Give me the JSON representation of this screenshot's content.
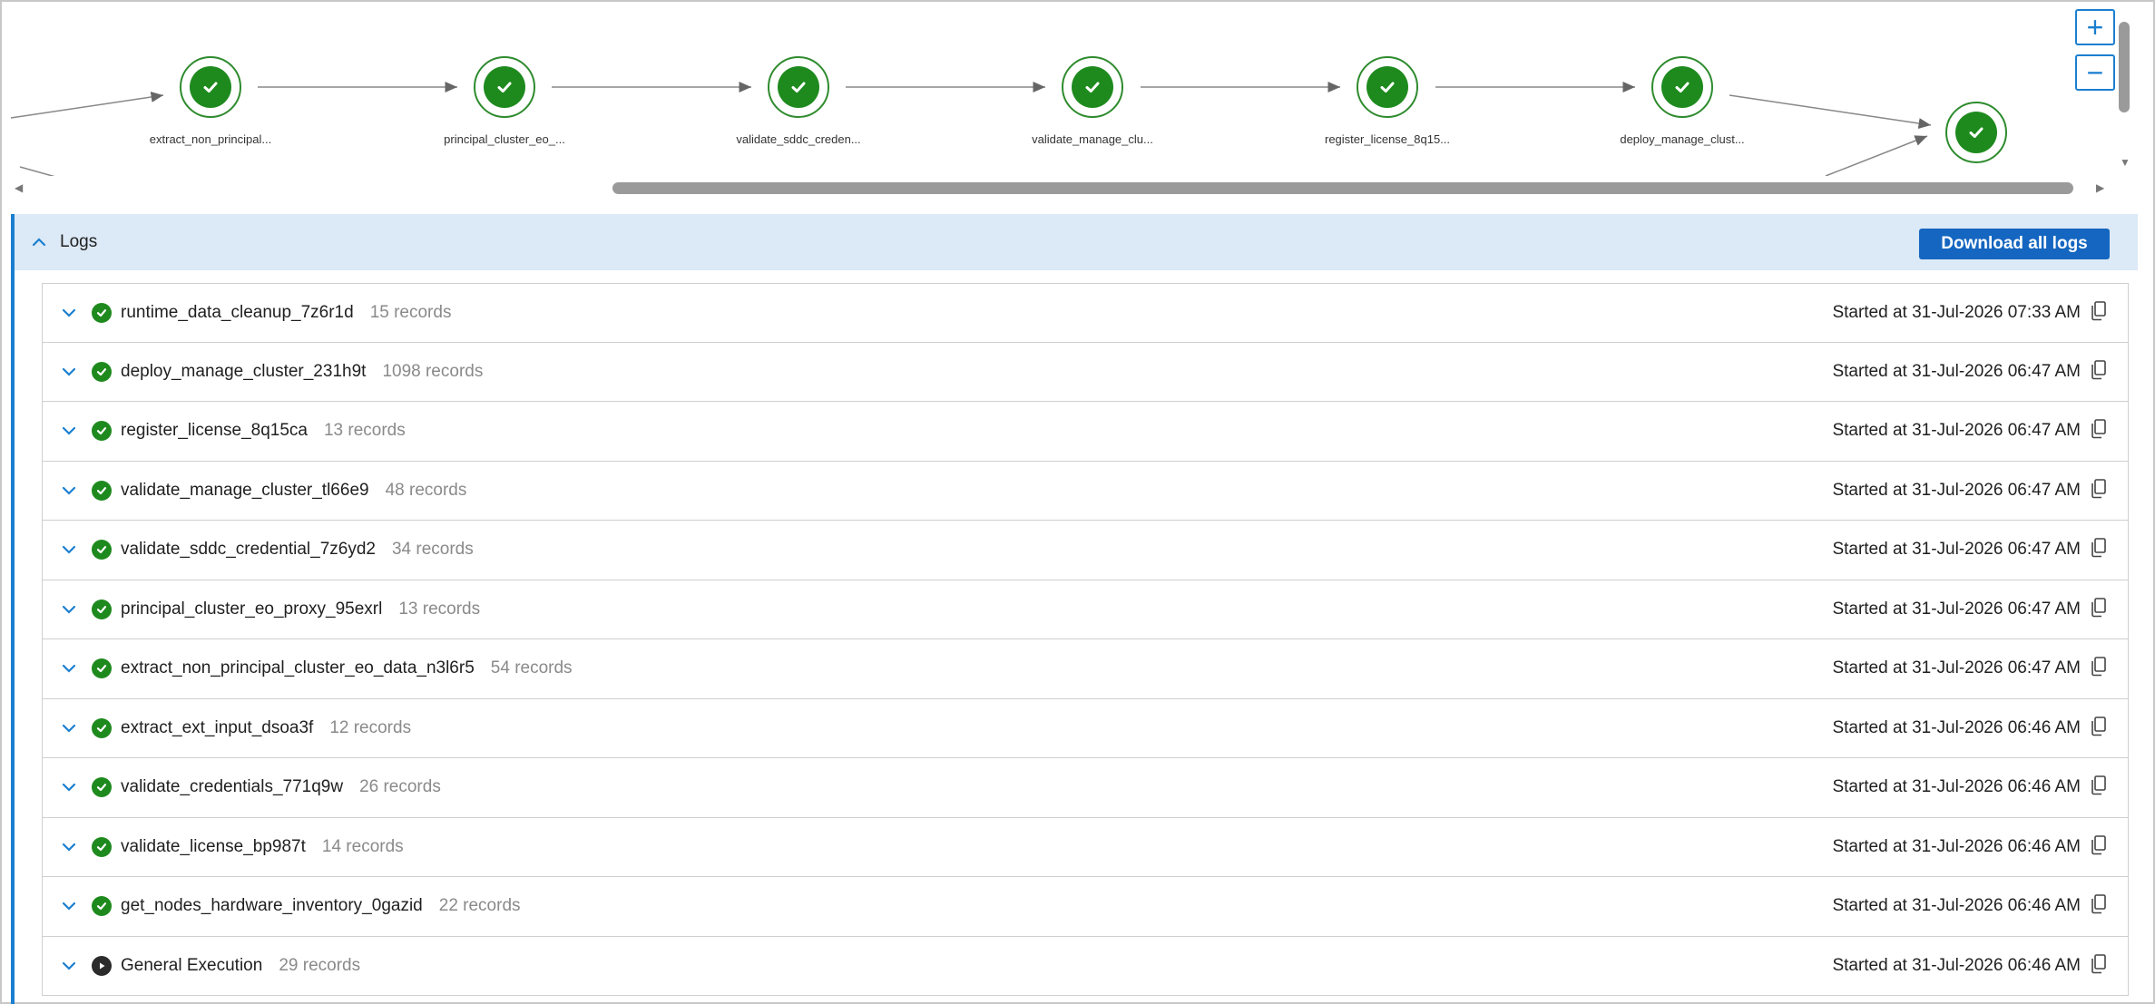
{
  "graph": {
    "nodes": [
      {
        "label": "extract_non_principal...",
        "status": "success"
      },
      {
        "label": "principal_cluster_eo_...",
        "status": "success"
      },
      {
        "label": "validate_sddc_creden...",
        "status": "success"
      },
      {
        "label": "validate_manage_clu...",
        "status": "success"
      },
      {
        "label": "register_license_8q15...",
        "status": "success"
      },
      {
        "label": "deploy_manage_clust...",
        "status": "success"
      },
      {
        "label": "",
        "status": "success"
      }
    ],
    "zoom_in": "+",
    "zoom_out": "−",
    "node_color": "#1e8a1e"
  },
  "logs": {
    "title": "Logs",
    "download_label": "Download all logs",
    "accent_color": "#1a7fd0",
    "items": [
      {
        "name": "runtime_data_cleanup_7z6r1d",
        "count": "15 records",
        "started": "Started at 31-Jul-2026 07:33 AM",
        "status": "success"
      },
      {
        "name": "deploy_manage_cluster_231h9t",
        "count": "1098 records",
        "started": "Started at 31-Jul-2026 06:47 AM",
        "status": "success"
      },
      {
        "name": "register_license_8q15ca",
        "count": "13 records",
        "started": "Started at 31-Jul-2026 06:47 AM",
        "status": "success"
      },
      {
        "name": "validate_manage_cluster_tl66e9",
        "count": "48 records",
        "started": "Started at 31-Jul-2026 06:47 AM",
        "status": "success"
      },
      {
        "name": "validate_sddc_credential_7z6yd2",
        "count": "34 records",
        "started": "Started at 31-Jul-2026 06:47 AM",
        "status": "success"
      },
      {
        "name": "principal_cluster_eo_proxy_95exrl",
        "count": "13 records",
        "started": "Started at 31-Jul-2026 06:47 AM",
        "status": "success"
      },
      {
        "name": "extract_non_principal_cluster_eo_data_n3l6r5",
        "count": "54 records",
        "started": "Started at 31-Jul-2026 06:47 AM",
        "status": "success"
      },
      {
        "name": "extract_ext_input_dsoa3f",
        "count": "12 records",
        "started": "Started at 31-Jul-2026 06:46 AM",
        "status": "success"
      },
      {
        "name": "validate_credentials_771q9w",
        "count": "26 records",
        "started": "Started at 31-Jul-2026 06:46 AM",
        "status": "success"
      },
      {
        "name": "validate_license_bp987t",
        "count": "14 records",
        "started": "Started at 31-Jul-2026 06:46 AM",
        "status": "success"
      },
      {
        "name": "get_nodes_hardware_inventory_0gazid",
        "count": "22 records",
        "started": "Started at 31-Jul-2026 06:46 AM",
        "status": "success"
      },
      {
        "name": "General Execution",
        "count": "29 records",
        "started": "Started at 31-Jul-2026 06:46 AM",
        "status": "running"
      }
    ]
  }
}
